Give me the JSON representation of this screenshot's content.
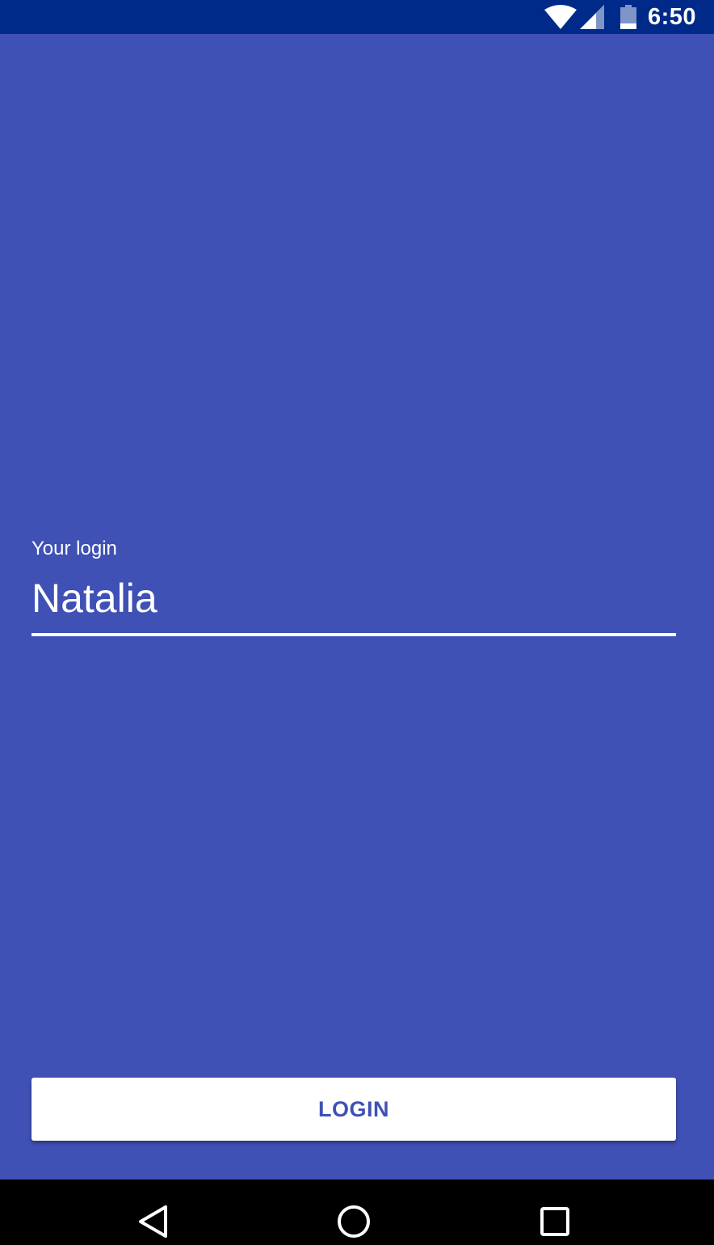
{
  "status_bar": {
    "time": "6:50",
    "icons": [
      "wifi-icon",
      "cellular-signal-icon",
      "battery-icon"
    ],
    "background_color": "#002a8a"
  },
  "form": {
    "login_label": "Your login",
    "login_value": "Natalia",
    "login_button_label": "LOGIN"
  },
  "nav_bar": {
    "icons": [
      "back-icon",
      "home-icon",
      "recent-apps-icon"
    ]
  },
  "colors": {
    "primary": "#3f51b5",
    "status_bar": "#002a8a",
    "button_background": "#ffffff",
    "text_on_primary": "#ffffff"
  }
}
